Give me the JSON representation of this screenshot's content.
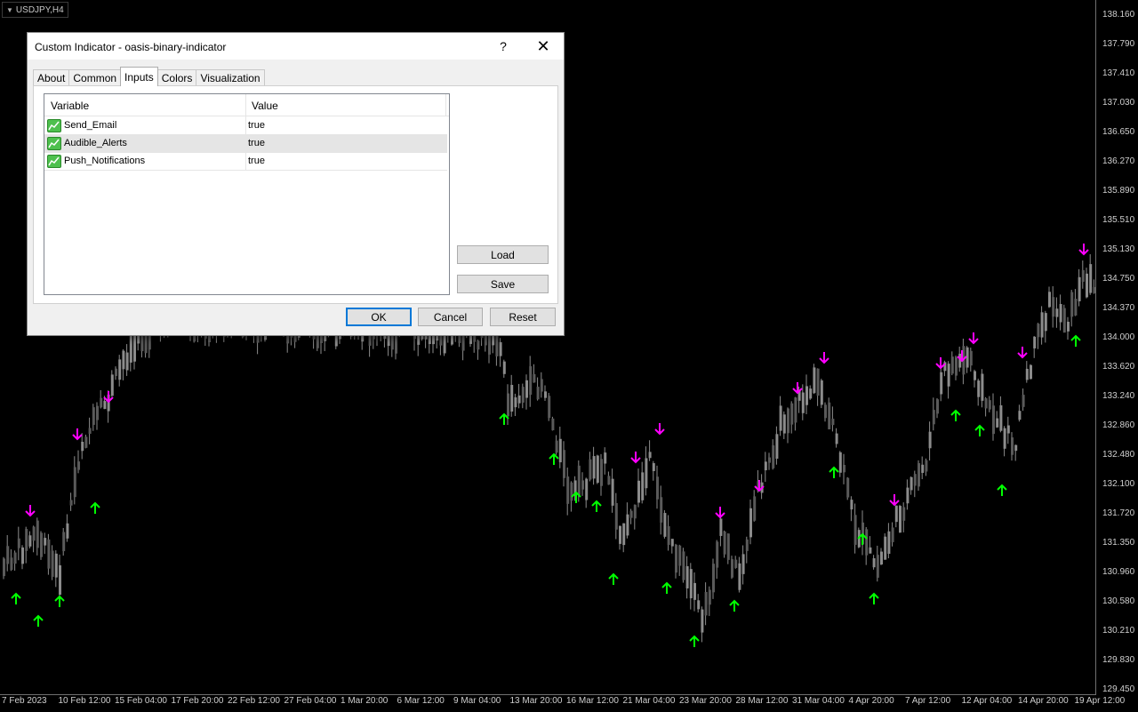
{
  "chart": {
    "symbol_label": "USDJPY,H4",
    "price_labels": [
      "138.160",
      "137.790",
      "137.410",
      "137.030",
      "136.650",
      "136.270",
      "135.890",
      "135.510",
      "135.130",
      "134.750",
      "134.370",
      "134.000",
      "133.620",
      "133.240",
      "132.860",
      "132.480",
      "132.100",
      "131.720",
      "131.350",
      "130.960",
      "130.580",
      "130.210",
      "129.830",
      "129.450"
    ],
    "time_labels": [
      "7 Feb 2023",
      "10 Feb 12:00",
      "15 Feb 04:00",
      "17 Feb 20:00",
      "22 Feb 12:00",
      "27 Feb 04:00",
      "1 Mar 20:00",
      "6 Mar 12:00",
      "9 Mar 04:00",
      "13 Mar 20:00",
      "16 Mar 12:00",
      "21 Mar 04:00",
      "23 Mar 20:00",
      "28 Mar 12:00",
      "31 Mar 04:00",
      "4 Apr 20:00",
      "7 Apr 12:00",
      "12 Apr 04:00",
      "14 Apr 20:00",
      "19 Apr 12:00"
    ],
    "colors": {
      "background": "#000000",
      "candle": "#8c8c8c",
      "buy_arrow": "#00ff00",
      "sell_arrow": "#ff00ff"
    }
  },
  "dialog": {
    "title": "Custom Indicator - oasis-binary-indicator",
    "help": "?",
    "close": "✕",
    "tabs": [
      "About",
      "Common",
      "Inputs",
      "Colors",
      "Visualization"
    ],
    "active_tab": "Inputs",
    "grid": {
      "headers": [
        "Variable",
        "Value"
      ],
      "rows": [
        {
          "variable": "Send_Email",
          "value": "true"
        },
        {
          "variable": "Audible_Alerts",
          "value": "true"
        },
        {
          "variable": "Push_Notifications",
          "value": "true"
        }
      ]
    },
    "buttons": {
      "load": "Load",
      "save": "Save",
      "ok": "OK",
      "cancel": "Cancel",
      "reset": "Reset"
    }
  }
}
